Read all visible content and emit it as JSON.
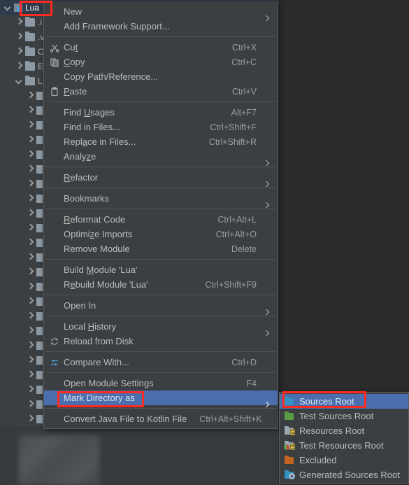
{
  "tree": {
    "root": {
      "label": "Lua",
      "icon": "module-icon",
      "selected": true,
      "expanded": true
    },
    "children": [
      {
        "label": ".i",
        "icon": "folder-icon",
        "indent": 1,
        "expanded": false
      },
      {
        "label": ".v",
        "icon": "folder-icon",
        "indent": 1,
        "expanded": false
      },
      {
        "label": "C",
        "icon": "folder-icon",
        "indent": 1,
        "expanded": false
      },
      {
        "label": "E",
        "icon": "folder-icon",
        "indent": 1,
        "expanded": false
      },
      {
        "label": "L",
        "icon": "folder-icon",
        "indent": 1,
        "expanded": true
      },
      {
        "label": "",
        "icon": "file-icon",
        "indent": 2,
        "expanded": false
      },
      {
        "label": "",
        "icon": "file-icon",
        "indent": 2,
        "expanded": false
      },
      {
        "label": "",
        "icon": "file-icon",
        "indent": 2,
        "expanded": false
      },
      {
        "label": "",
        "icon": "file-icon",
        "indent": 2,
        "expanded": false
      },
      {
        "label": "",
        "icon": "file-icon",
        "indent": 2,
        "expanded": false
      },
      {
        "label": "",
        "icon": "file-icon",
        "indent": 2,
        "expanded": false
      },
      {
        "label": "",
        "icon": "file-icon",
        "indent": 2,
        "expanded": false
      },
      {
        "label": "",
        "icon": "file-icon",
        "indent": 2,
        "expanded": false
      },
      {
        "label": "",
        "icon": "file-icon",
        "indent": 2,
        "expanded": false
      },
      {
        "label": "",
        "icon": "file-icon",
        "indent": 2,
        "expanded": false
      },
      {
        "label": "",
        "icon": "file-icon",
        "indent": 2,
        "expanded": false
      },
      {
        "label": "",
        "icon": "file-icon",
        "indent": 2,
        "expanded": false
      },
      {
        "label": "",
        "icon": "file-icon",
        "indent": 2,
        "expanded": false
      },
      {
        "label": "",
        "icon": "file-icon",
        "indent": 2,
        "expanded": false
      },
      {
        "label": "",
        "icon": "file-icon",
        "indent": 2,
        "expanded": false
      },
      {
        "label": "",
        "icon": "file-icon",
        "indent": 2,
        "expanded": false
      },
      {
        "label": "",
        "icon": "file-icon",
        "indent": 2,
        "expanded": false
      },
      {
        "label": "",
        "icon": "file-icon",
        "indent": 2,
        "expanded": false
      },
      {
        "label": "",
        "icon": "file-icon",
        "indent": 2,
        "expanded": false
      },
      {
        "label": "",
        "icon": "file-icon",
        "indent": 2,
        "expanded": false
      },
      {
        "label": "",
        "icon": "file-icon",
        "indent": 2,
        "expanded": false
      },
      {
        "label": "",
        "icon": "file-icon",
        "indent": 2,
        "expanded": false
      },
      {
        "label": "",
        "icon": "file-icon",
        "indent": 2,
        "expanded": false
      }
    ]
  },
  "context_menu": {
    "items": [
      {
        "label": "New",
        "shortcut": "",
        "icon": "",
        "submenu": true,
        "mnemonic": ""
      },
      {
        "label": "Add Framework Support...",
        "shortcut": "",
        "icon": "",
        "submenu": false,
        "mnemonic": ""
      },
      {
        "separator": true
      },
      {
        "label": "Cut",
        "shortcut": "Ctrl+X",
        "icon": "scissors-icon",
        "submenu": false,
        "mnemonic": "t"
      },
      {
        "label": "Copy",
        "shortcut": "Ctrl+C",
        "icon": "copy-icon",
        "submenu": false,
        "mnemonic": "C"
      },
      {
        "label": "Copy Path/Reference...",
        "shortcut": "",
        "icon": "",
        "submenu": false,
        "mnemonic": ""
      },
      {
        "label": "Paste",
        "shortcut": "Ctrl+V",
        "icon": "paste-icon",
        "submenu": false,
        "mnemonic": "P"
      },
      {
        "separator": true
      },
      {
        "label": "Find Usages",
        "shortcut": "Alt+F7",
        "icon": "",
        "submenu": false,
        "mnemonic": "U"
      },
      {
        "label": "Find in Files...",
        "shortcut": "Ctrl+Shift+F",
        "icon": "",
        "submenu": false,
        "mnemonic": ""
      },
      {
        "label": "Replace in Files...",
        "shortcut": "Ctrl+Shift+R",
        "icon": "",
        "submenu": false,
        "mnemonic": "a"
      },
      {
        "label": "Analyze",
        "shortcut": "",
        "icon": "",
        "submenu": true,
        "mnemonic": "z"
      },
      {
        "separator": true
      },
      {
        "label": "Refactor",
        "shortcut": "",
        "icon": "",
        "submenu": true,
        "mnemonic": "R"
      },
      {
        "separator": true
      },
      {
        "label": "Bookmarks",
        "shortcut": "",
        "icon": "",
        "submenu": true,
        "mnemonic": ""
      },
      {
        "separator": true
      },
      {
        "label": "Reformat Code",
        "shortcut": "Ctrl+Alt+L",
        "icon": "",
        "submenu": false,
        "mnemonic": "R"
      },
      {
        "label": "Optimize Imports",
        "shortcut": "Ctrl+Alt+O",
        "icon": "",
        "submenu": false,
        "mnemonic": "z"
      },
      {
        "label": "Remove Module",
        "shortcut": "Delete",
        "icon": "",
        "submenu": false,
        "mnemonic": ""
      },
      {
        "separator": true
      },
      {
        "label": "Build Module 'Lua'",
        "shortcut": "",
        "icon": "",
        "submenu": false,
        "mnemonic": "M"
      },
      {
        "label": "Rebuild Module 'Lua'",
        "shortcut": "Ctrl+Shift+F9",
        "icon": "",
        "submenu": false,
        "mnemonic": "e"
      },
      {
        "separator": true
      },
      {
        "label": "Open In",
        "shortcut": "",
        "icon": "",
        "submenu": true,
        "mnemonic": ""
      },
      {
        "separator": true
      },
      {
        "label": "Local History",
        "shortcut": "",
        "icon": "",
        "submenu": true,
        "mnemonic": "H"
      },
      {
        "label": "Reload from Disk",
        "shortcut": "",
        "icon": "reload-icon",
        "submenu": false,
        "mnemonic": ""
      },
      {
        "separator": true
      },
      {
        "label": "Compare With...",
        "shortcut": "Ctrl+D",
        "icon": "compare-icon",
        "submenu": false,
        "mnemonic": ""
      },
      {
        "separator": true
      },
      {
        "label": "Open Module Settings",
        "shortcut": "F4",
        "icon": "",
        "submenu": false,
        "mnemonic": ""
      },
      {
        "label": "Mark Directory as",
        "shortcut": "",
        "icon": "",
        "submenu": true,
        "mnemonic": "",
        "highlighted": true
      },
      {
        "separator": true
      },
      {
        "label": "Convert Java File to Kotlin File",
        "shortcut": "Ctrl+Alt+Shift+K",
        "icon": "",
        "submenu": false,
        "mnemonic": ""
      }
    ]
  },
  "submenu": {
    "parent": "Mark Directory as",
    "items": [
      {
        "label": "Sources Root",
        "icon": "folder-blue-icon",
        "color": "#3592c4",
        "highlighted": true
      },
      {
        "label": "Test Sources Root",
        "icon": "folder-green-icon",
        "color": "#5a9c44",
        "highlighted": false
      },
      {
        "label": "Resources Root",
        "icon": "folder-resources-icon",
        "color": "#9aa7b0",
        "highlighted": false
      },
      {
        "label": "Test Resources Root",
        "icon": "folder-test-resources-icon",
        "color": "#9aa7b0",
        "highlighted": false
      },
      {
        "label": "Excluded",
        "icon": "folder-orange-icon",
        "color": "#c2631f",
        "highlighted": false
      },
      {
        "label": "Generated Sources Root",
        "icon": "folder-generated-icon",
        "color": "#3592c4",
        "highlighted": false
      }
    ]
  },
  "annotations": {
    "boxes": [
      {
        "name": "lua-module-highlight",
        "color": "#ff2a20"
      },
      {
        "name": "mark-directory-highlight",
        "color": "#ff2a20"
      },
      {
        "name": "sources-root-highlight",
        "color": "#ff2a20"
      }
    ]
  },
  "theme": {
    "menu_bg": "#3c3f41",
    "editor_bg": "#2b2b2b",
    "selection_blue": "#4b6eaf",
    "tree_selection": "#2f3a4a",
    "text": "#bbbbbb",
    "separator": "#515455"
  }
}
